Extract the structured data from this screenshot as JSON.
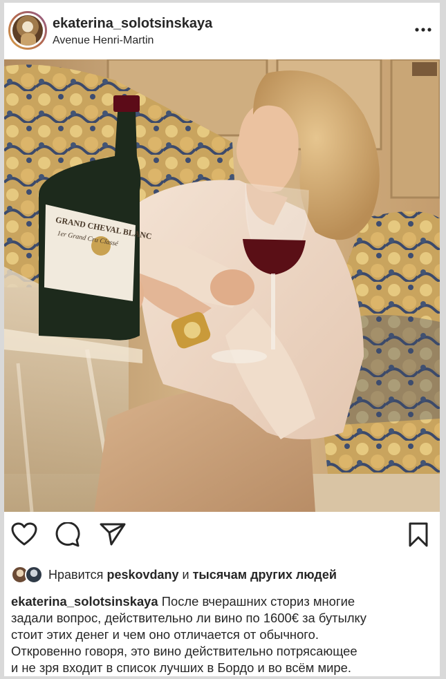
{
  "post": {
    "username": "ekaterina_solotsinskaya",
    "location": "Avenue Henri-Martin"
  },
  "photo": {
    "bottle_label_line1": "GRAND CHEVAL BLANC",
    "bottle_label_line2": "1er Grand Cru Classé"
  },
  "actions": {
    "like_icon": "heart-icon",
    "comment_icon": "comment-icon",
    "share_icon": "paper-plane-icon",
    "save_icon": "bookmark-icon"
  },
  "likes": {
    "prefix": "Нравится",
    "user": "peskovdany",
    "conjunction": "и",
    "others": "тысячам других людей"
  },
  "caption": {
    "username": "ekaterina_solotsinskaya",
    "line1": "После вчерашних сториз многие",
    "line2": "задали вопрос, действительно ли вино по 1600€ за бутылку",
    "line3": "стоит этих денег и чем оно отличается от обычного.",
    "line4": "Откровенно говоря, это вино действительно потрясающее",
    "line5": "и не зря входит в список лучших в Бордо и во всём мире."
  },
  "colors": {
    "text": "#262626",
    "background": "#ffffff"
  }
}
